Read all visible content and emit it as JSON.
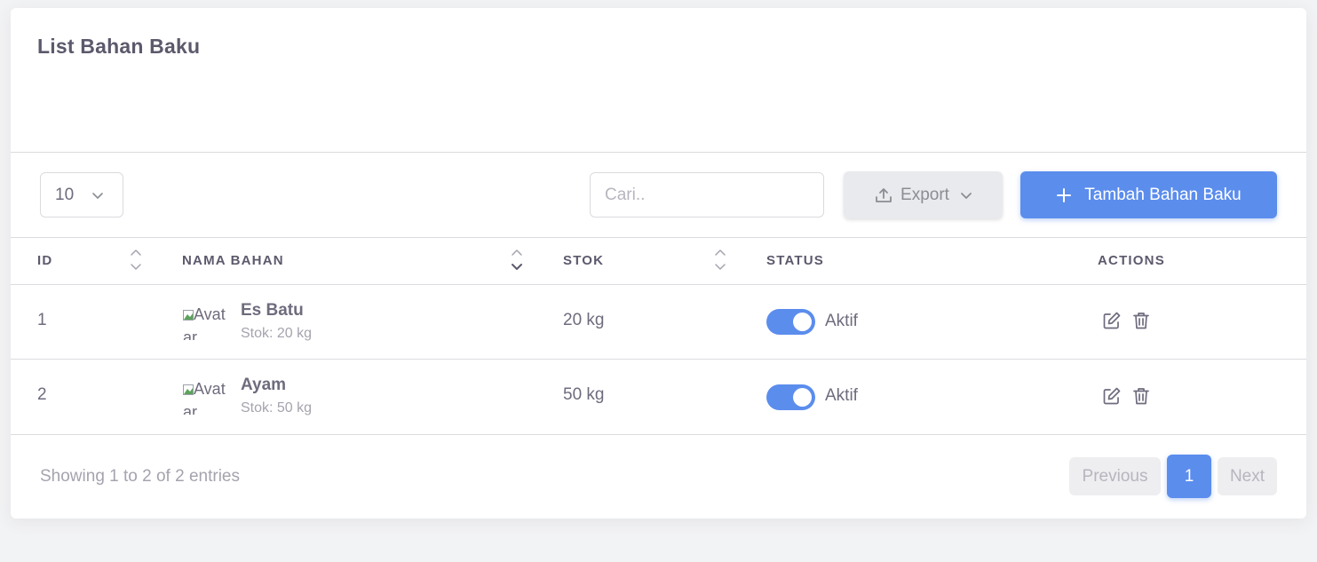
{
  "card": {
    "title": "List Bahan Baku"
  },
  "toolbar": {
    "page_length": "10",
    "search_placeholder": "Cari..",
    "export_label": "Export",
    "add_label": "Tambah Bahan Baku"
  },
  "table": {
    "columns": [
      "ID",
      "NAMA BAHAN",
      "STOK",
      "STATUS",
      "ACTIONS"
    ],
    "rows": [
      {
        "id": "1",
        "avatar_alt": "Avatar",
        "name": "Es Batu",
        "sub": "Stok: 20 kg",
        "stock": "20 kg",
        "status": "Aktif",
        "active": true
      },
      {
        "id": "2",
        "avatar_alt": "Avatar",
        "name": "Ayam",
        "sub": "Stok: 50 kg",
        "stock": "50 kg",
        "status": "Aktif",
        "active": true
      }
    ]
  },
  "footer": {
    "info": "Showing 1 to 2 of 2 entries",
    "prev": "Previous",
    "page": "1",
    "next": "Next"
  },
  "colors": {
    "primary": "#5b8ded",
    "text": "#6f6b7d",
    "heading": "#5d596c"
  },
  "icons": [
    "chevron-down-icon",
    "upload-icon",
    "plus-icon",
    "sort-icon",
    "broken-image-icon",
    "edit-icon",
    "trash-icon"
  ]
}
